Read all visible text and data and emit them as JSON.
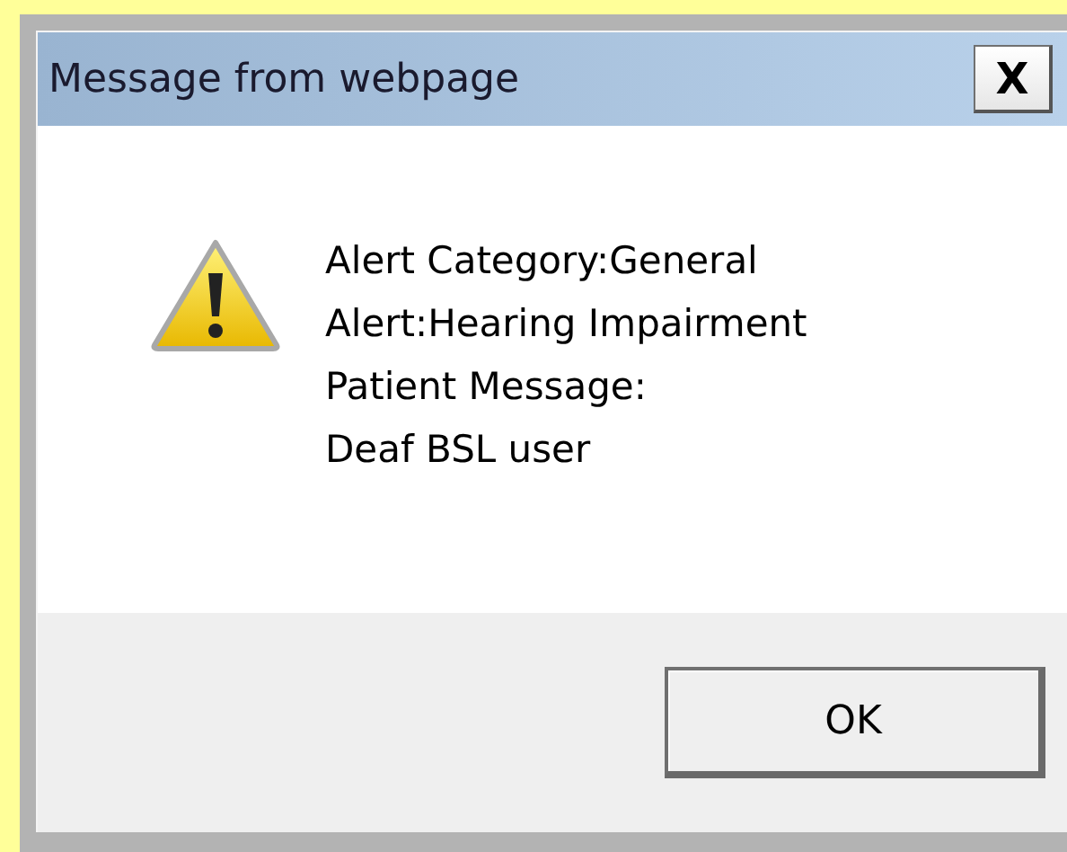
{
  "window": {
    "title": "Message from webpage",
    "close": "X"
  },
  "message": {
    "lines": [
      "Alert Category:General",
      "Alert:Hearing Impairment",
      "Patient Message:",
      "Deaf BSL user"
    ]
  },
  "buttons": [
    "OK"
  ]
}
